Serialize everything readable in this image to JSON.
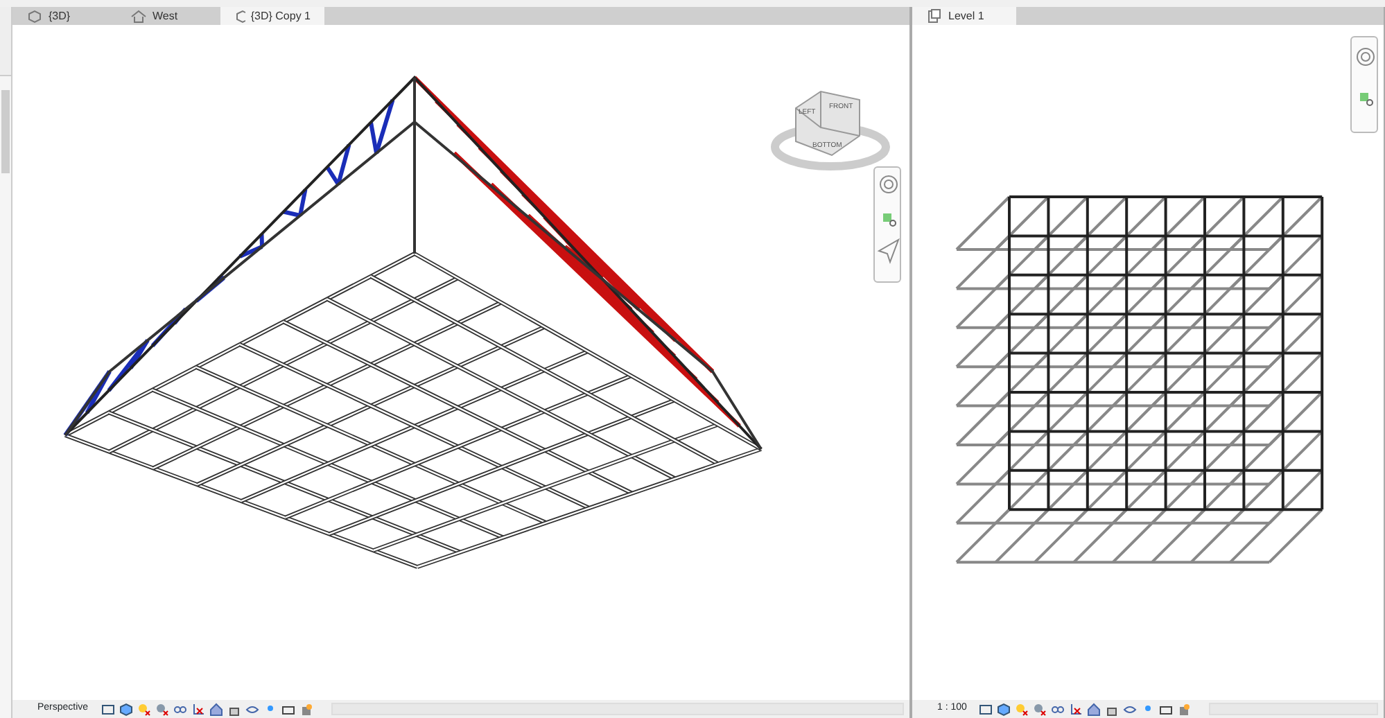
{
  "left_view": {
    "tabs": [
      {
        "label": "{3D}",
        "kind": "perspective",
        "selected": false
      },
      {
        "label": "West",
        "kind": "elevation",
        "selected": false
      },
      {
        "label": "{3D} Copy 1",
        "kind": "perspective",
        "selected": true
      }
    ],
    "viewcube": {
      "faces": [
        "LEFT",
        "FRONT",
        "BOTTOM"
      ]
    },
    "status_bar": {
      "label": "Perspective"
    }
  },
  "right_view": {
    "tabs": [
      {
        "label": "Level 1",
        "kind": "plan",
        "selected": true
      }
    ],
    "status_bar": {
      "label": "1 : 100"
    }
  }
}
